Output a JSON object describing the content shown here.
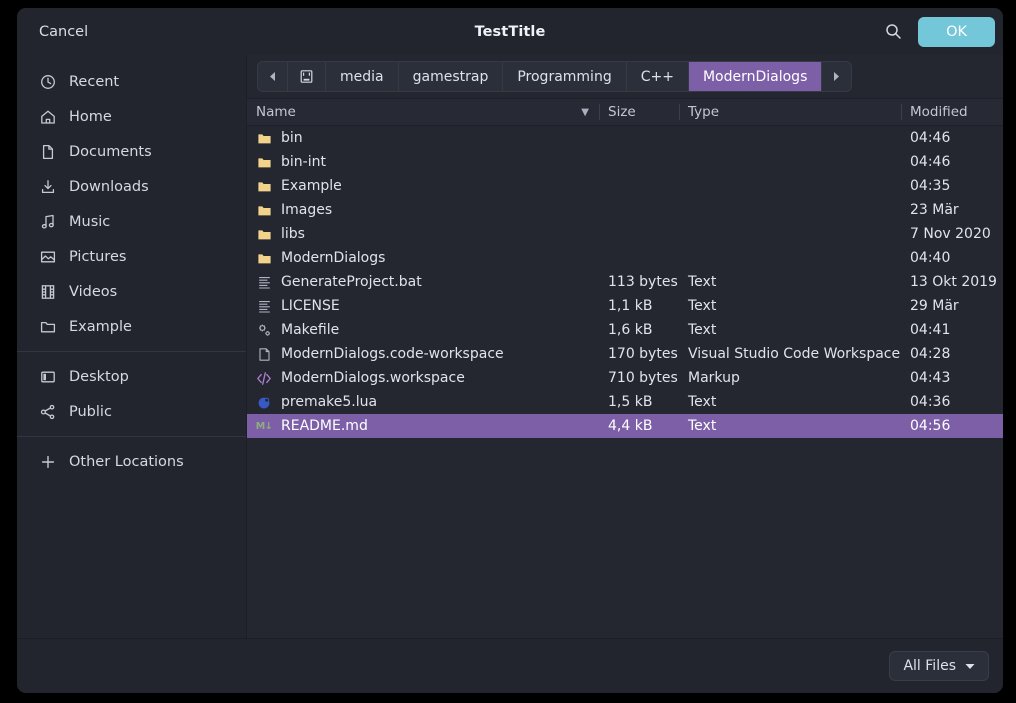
{
  "header": {
    "cancel_label": "Cancel",
    "title": "TestTitle",
    "search_icon": "search-icon",
    "ok_label": "OK",
    "accent_ok": "#74c7d8"
  },
  "sidebar": {
    "groups": [
      {
        "items": [
          {
            "label": "Recent",
            "icon": "clock-icon"
          },
          {
            "label": "Home",
            "icon": "home-icon"
          },
          {
            "label": "Documents",
            "icon": "document-icon"
          },
          {
            "label": "Downloads",
            "icon": "download-icon"
          },
          {
            "label": "Music",
            "icon": "music-note-icon"
          },
          {
            "label": "Pictures",
            "icon": "image-icon"
          },
          {
            "label": "Videos",
            "icon": "film-icon"
          },
          {
            "label": "Example",
            "icon": "folder-icon"
          }
        ]
      },
      {
        "items": [
          {
            "label": "Desktop",
            "icon": "desktop-icon"
          },
          {
            "label": "Public",
            "icon": "share-icon"
          }
        ]
      },
      {
        "items": [
          {
            "label": "Other Locations",
            "icon": "plus-icon"
          }
        ]
      }
    ]
  },
  "pathbar": {
    "back_icon": "chevron-left-icon",
    "forward_icon": "chevron-right-icon",
    "root_icon": "harddisk-icon",
    "crumbs": [
      {
        "label": "media",
        "active": false
      },
      {
        "label": "gamestrap",
        "active": false
      },
      {
        "label": "Programming",
        "active": false
      },
      {
        "label": "C++",
        "active": false
      },
      {
        "label": "ModernDialogs",
        "active": true
      }
    ],
    "active_color": "#7d5fa8"
  },
  "file_list": {
    "columns": [
      {
        "key": "name",
        "label": "Name",
        "sorted": true,
        "sort_caret": "▼"
      },
      {
        "key": "size",
        "label": "Size"
      },
      {
        "key": "type",
        "label": "Type"
      },
      {
        "key": "modified",
        "label": "Modified"
      }
    ],
    "rows": [
      {
        "icon": "folder-icon",
        "name": "bin",
        "size": "",
        "type": "",
        "modified": "04:46",
        "selected": false
      },
      {
        "icon": "folder-icon",
        "name": "bin-int",
        "size": "",
        "type": "",
        "modified": "04:46",
        "selected": false
      },
      {
        "icon": "folder-icon",
        "name": "Example",
        "size": "",
        "type": "",
        "modified": "04:35",
        "selected": false
      },
      {
        "icon": "folder-icon",
        "name": "Images",
        "size": "",
        "type": "",
        "modified": "23 Mär",
        "selected": false
      },
      {
        "icon": "folder-icon",
        "name": "libs",
        "size": "",
        "type": "",
        "modified": "7 Nov 2020",
        "selected": false
      },
      {
        "icon": "folder-icon",
        "name": "ModernDialogs",
        "size": "",
        "type": "",
        "modified": "04:40",
        "selected": false
      },
      {
        "icon": "text-file-icon",
        "name": "GenerateProject.bat",
        "size": "113 bytes",
        "type": "Text",
        "modified": "13 Okt 2019",
        "selected": false
      },
      {
        "icon": "text-file-icon",
        "name": "LICENSE",
        "size": "1,1 kB",
        "type": "Text",
        "modified": "29 Mär",
        "selected": false
      },
      {
        "icon": "makefile-icon",
        "name": "Makefile",
        "size": "1,6 kB",
        "type": "Text",
        "modified": "04:41",
        "selected": false
      },
      {
        "icon": "blank-page-icon",
        "name": "ModernDialogs.code-workspace",
        "size": "170 bytes",
        "type": "Visual Studio Code Workspace",
        "modified": "04:28",
        "selected": false
      },
      {
        "icon": "markup-code-icon",
        "name": "ModernDialogs.workspace",
        "size": "710 bytes",
        "type": "Markup",
        "modified": "04:43",
        "selected": false
      },
      {
        "icon": "lua-icon",
        "name": "premake5.lua",
        "size": "1,5 kB",
        "type": "Text",
        "modified": "04:36",
        "selected": false
      },
      {
        "icon": "markdown-icon",
        "name": "README.md",
        "size": "4,4 kB",
        "type": "Text",
        "modified": "04:56",
        "selected": true
      }
    ],
    "selection_color": "#7d5fa8",
    "folder_color": "#f3d28b"
  },
  "footer": {
    "filter_label": "All Files",
    "filter_caret_icon": "chevron-down-icon"
  }
}
